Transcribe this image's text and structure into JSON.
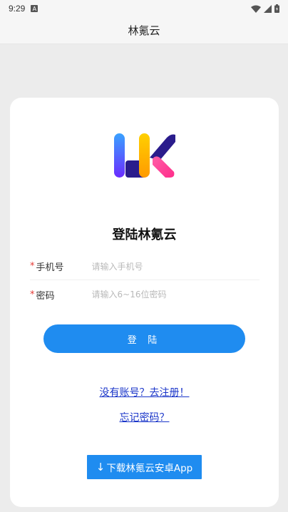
{
  "status": {
    "time": "9:29"
  },
  "appbar": {
    "title": "林氪云"
  },
  "login": {
    "title": "登陆林氪云",
    "phone": {
      "label": "手机号",
      "placeholder": "请输入手机号"
    },
    "password": {
      "label": "密码",
      "placeholder": "请输入6~16位密码"
    },
    "submit_label": "登 陆",
    "register_link": "没有账号？去注册！",
    "forgot_link": "忘记密码？",
    "download_label": "下载林氪云安卓App",
    "download_arrow": "↓"
  },
  "colors": {
    "primary": "#1f8cf0",
    "link": "#1a35c9",
    "required": "#e53935"
  },
  "icons": {
    "status": [
      "app-notification-icon",
      "wifi-icon",
      "signal-icon",
      "battery-icon"
    ],
    "logo": "lk-logo",
    "download": "download-arrow-icon"
  }
}
